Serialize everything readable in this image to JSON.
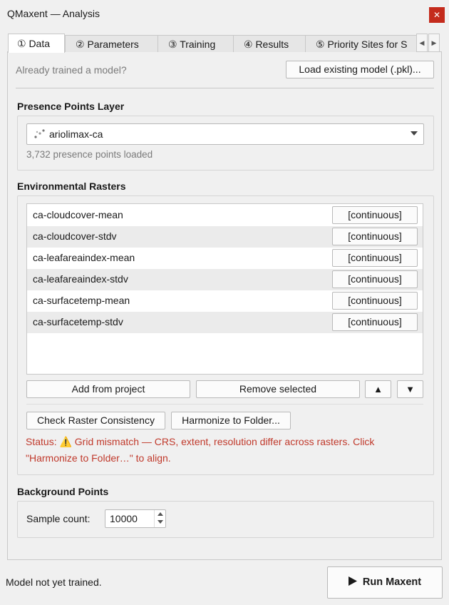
{
  "window": {
    "title": "QMaxent — Analysis",
    "close_glyph": "✕"
  },
  "tabs": [
    {
      "label": "① Data"
    },
    {
      "label": "② Parameters"
    },
    {
      "label": "③ Training"
    },
    {
      "label": "④ Results"
    },
    {
      "label": "⑤ Priority Sites for S"
    }
  ],
  "tab_scroll": {
    "left": "◀",
    "right": "▶"
  },
  "load_section": {
    "prompt": "Already trained a model?",
    "load_button": "Load existing model (.pkl)..."
  },
  "presence": {
    "title": "Presence Points Layer",
    "icon": "point-layer-icon",
    "selected_layer": "ariolimax-ca",
    "count_text": "3,732 presence points loaded"
  },
  "rasters": {
    "title": "Environmental Rasters",
    "items": [
      {
        "name": "ca-cloudcover-mean",
        "type": "[continuous]"
      },
      {
        "name": "ca-cloudcover-stdv",
        "type": "[continuous]"
      },
      {
        "name": "ca-leafareaindex-mean",
        "type": "[continuous]"
      },
      {
        "name": "ca-leafareaindex-stdv",
        "type": "[continuous]"
      },
      {
        "name": "ca-surfacetemp-mean",
        "type": "[continuous]"
      },
      {
        "name": "ca-surfacetemp-stdv",
        "type": "[continuous]"
      }
    ],
    "add_button": "Add from project",
    "remove_button": "Remove selected",
    "up_glyph": "▲",
    "down_glyph": "▼",
    "check_button": "Check Raster Consistency",
    "harmonize_button": "Harmonize to Folder...",
    "status_line1": "Status: ⚠️ Grid mismatch — CRS, extent, resolution differ across rasters. Click",
    "status_line2": "\"Harmonize to Folder…\" to align.",
    "status_color": "#c0392b"
  },
  "background": {
    "title": "Background Points",
    "sample_label": "Sample count:",
    "sample_value": "10000"
  },
  "footer": {
    "status": "Model not yet trained.",
    "run_button": "Run Maxent"
  }
}
